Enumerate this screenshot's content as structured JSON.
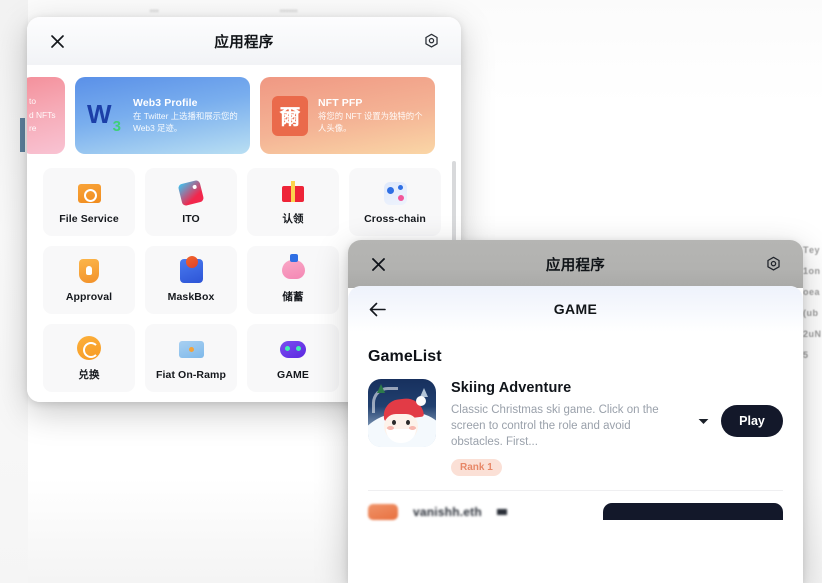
{
  "apps_dialog": {
    "title": "应用程序",
    "close_label": "×",
    "close_icon": "close-icon",
    "settings_icon": "gear-icon",
    "banners": [
      {
        "id": "crypto-nfts",
        "title": "",
        "line1": "to",
        "line2": "d NFTs",
        "line3": "re",
        "color": "#f4909b",
        "clipped": true
      },
      {
        "id": "web3-profile",
        "title": "Web3 Profile",
        "subtitle": "在 Twitter 上选播和展示您的 Web3 足迹。",
        "logo_text": "W",
        "logo_sub": "3",
        "color": "#5a90e8"
      },
      {
        "id": "nft-pfp",
        "title": "NFT PFP",
        "subtitle": "将您的 NFT 设置为独特的个人头像。",
        "logo_text": "爾",
        "color": "#f09883"
      }
    ],
    "tiles": [
      {
        "label": "File Service",
        "icon": "folder-icon"
      },
      {
        "label": "ITO",
        "icon": "tag-icon"
      },
      {
        "label": "认领",
        "icon": "gift-icon"
      },
      {
        "label": "Cross-chain",
        "icon": "cross-chain-icon"
      },
      {
        "label": "Approval",
        "icon": "shield-icon"
      },
      {
        "label": "MaskBox",
        "icon": "box-icon"
      },
      {
        "label": "储蓄",
        "icon": "piggy-bank-icon"
      },
      {
        "label": "兑换",
        "icon": "swap-icon"
      },
      {
        "label": "Fiat On-Ramp",
        "icon": "card-icon"
      },
      {
        "label": "GAME",
        "icon": "gamepad-icon"
      }
    ]
  },
  "game_dialog": {
    "title": "应用程序",
    "close_icon": "close-icon",
    "settings_icon": "gear-icon",
    "sub_title": "GAME",
    "back_icon": "back-arrow-icon",
    "list_title": "GameList",
    "games": [
      {
        "name": "Skiing Adventure",
        "description": "Classic Christmas ski game. Click on the screen to control the role and avoid obstacles. First...",
        "rank": "Rank 1",
        "play_label": "Play",
        "caret_icon": "chevron-down-icon",
        "thumbnail": "santa-skiing-thumbnail"
      },
      {
        "name": "vanishh.eth",
        "description": "",
        "rank": "",
        "play_label": "",
        "caret_icon": "chevron-down-icon",
        "thumbnail": "game-thumbnail"
      }
    ]
  },
  "background": {
    "edge_text": "T e y 1 o n o e a ( u b 2 u N 5"
  },
  "colors": {
    "accent_dark": "#13182a",
    "rank_badge_bg": "#fbe0d6",
    "rank_badge_fg": "#e78767",
    "banner_blue": "#5a90e8",
    "banner_orange": "#f09883",
    "banner_pink": "#f4909b",
    "titlebar_gray": "#b2b2b0"
  }
}
